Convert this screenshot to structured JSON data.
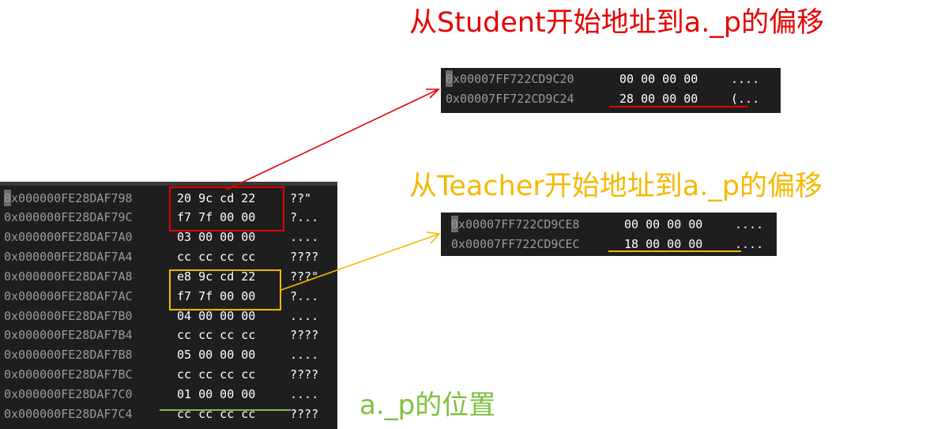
{
  "titles": {
    "student": "从Student开始地址到a._p的偏移",
    "teacher": "从Teacher开始地址到a._p的偏移",
    "position": "a._p的位置"
  },
  "colors": {
    "red": "#e50000",
    "orange": "#f5b800",
    "green": "#7fbf3f"
  },
  "left_panel": {
    "rows": [
      {
        "address": "0x000000FE28DAF798",
        "bytes": "20 9c cd 22",
        "ascii": "??\""
      },
      {
        "address": "0x000000FE28DAF79C",
        "bytes": "f7 7f 00 00",
        "ascii": "?..."
      },
      {
        "address": "0x000000FE28DAF7A0",
        "bytes": "03 00 00 00",
        "ascii": "...."
      },
      {
        "address": "0x000000FE28DAF7A4",
        "bytes": "cc cc cc cc",
        "ascii": "????"
      },
      {
        "address": "0x000000FE28DAF7A8",
        "bytes": "e8 9c cd 22",
        "ascii": "???\""
      },
      {
        "address": "0x000000FE28DAF7AC",
        "bytes": "f7 7f 00 00",
        "ascii": "?..."
      },
      {
        "address": "0x000000FE28DAF7B0",
        "bytes": "04 00 00 00",
        "ascii": "...."
      },
      {
        "address": "0x000000FE28DAF7B4",
        "bytes": "cc cc cc cc",
        "ascii": "????"
      },
      {
        "address": "0x000000FE28DAF7B8",
        "bytes": "05 00 00 00",
        "ascii": "...."
      },
      {
        "address": "0x000000FE28DAF7BC",
        "bytes": "cc cc cc cc",
        "ascii": "????"
      },
      {
        "address": "0x000000FE28DAF7C0",
        "bytes": "01 00 00 00",
        "ascii": "...."
      },
      {
        "address": "0x000000FE28DAF7C4",
        "bytes": "cc cc cc cc",
        "ascii": "????"
      }
    ]
  },
  "student_panel": {
    "rows": [
      {
        "address": "0x00007FF722CD9C20",
        "bytes": "00 00 00 00",
        "ascii": "...."
      },
      {
        "address": "0x00007FF722CD9C24",
        "bytes": "28 00 00 00",
        "ascii": "(..."
      }
    ]
  },
  "teacher_panel": {
    "rows": [
      {
        "address": "0x00007FF722CD9CE8",
        "bytes": "00 00 00 00",
        "ascii": "...."
      },
      {
        "address": "0x00007FF722CD9CEC",
        "bytes": "18 00 00 00",
        "ascii": "...."
      }
    ]
  }
}
